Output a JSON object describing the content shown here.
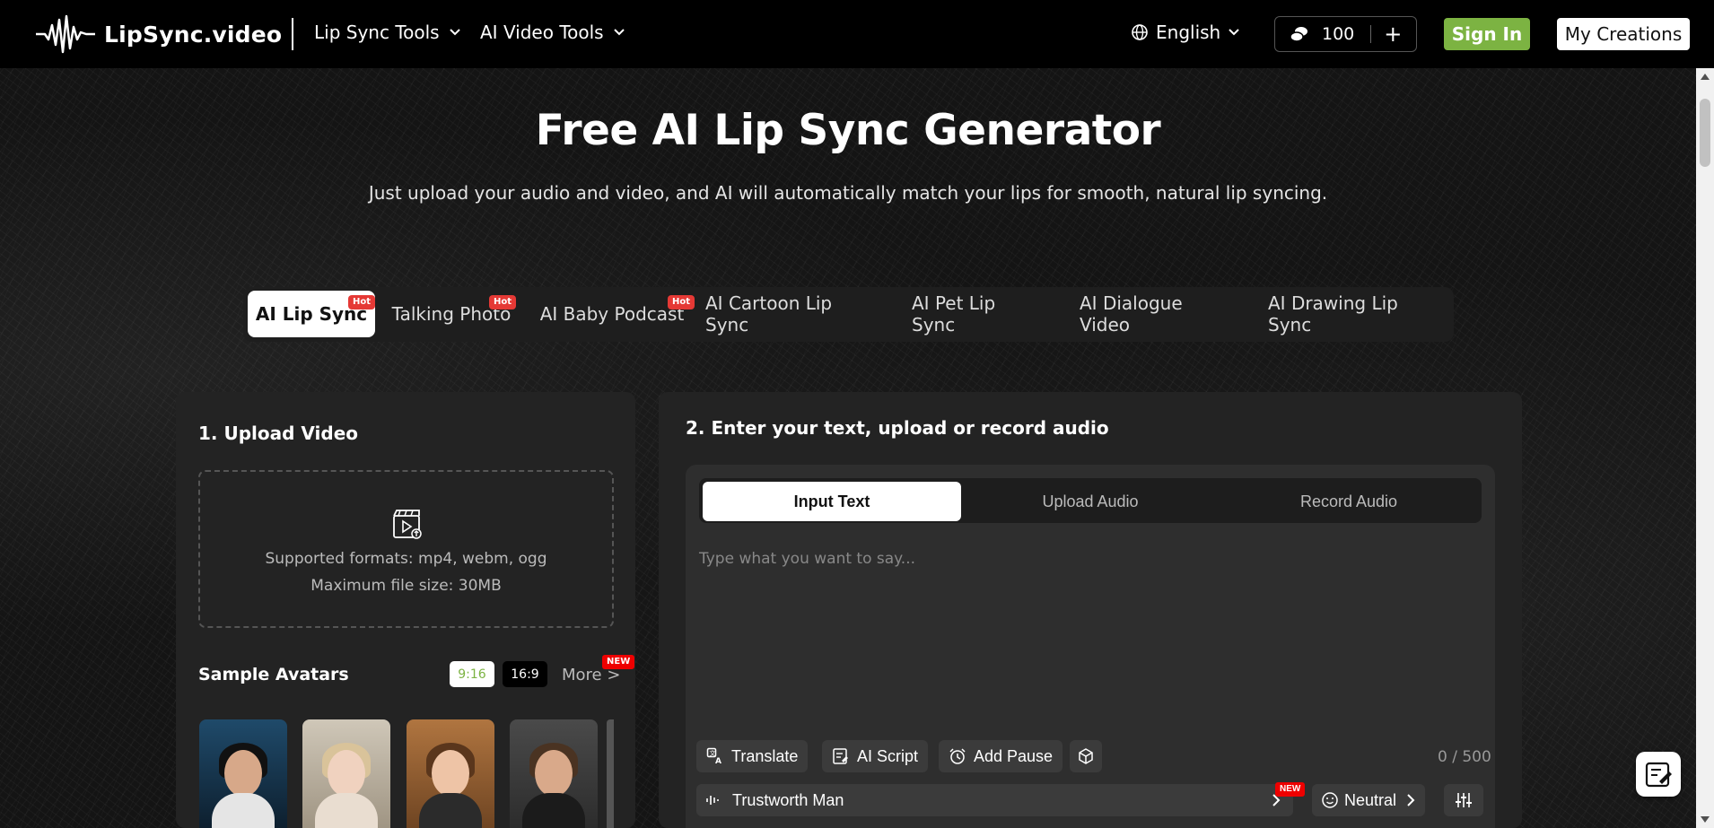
{
  "header": {
    "logo_text": "LipSync.video",
    "nav": [
      {
        "label": "Lip Sync Tools"
      },
      {
        "label": "AI Video Tools"
      }
    ],
    "language": "English",
    "credits": "100",
    "credits_add": "+",
    "sign_in": "Sign In",
    "my_creations": "My Creations"
  },
  "hero": {
    "title": "Free AI Lip Sync Generator",
    "subtitle": "Just upload your audio and video, and AI will automatically match your lips for smooth, natural lip syncing."
  },
  "tabs": [
    {
      "label": "AI Lip Sync",
      "badge": "Hot"
    },
    {
      "label": "Talking Photo",
      "badge": "Hot"
    },
    {
      "label": "AI Baby Podcast",
      "badge": "Hot"
    },
    {
      "label": "AI Cartoon Lip Sync"
    },
    {
      "label": "AI Pet Lip Sync"
    },
    {
      "label": "AI Dialogue Video"
    },
    {
      "label": "AI Drawing Lip Sync"
    }
  ],
  "upload": {
    "title": "1. Upload Video",
    "formats": "Supported formats: mp4, webm, ogg",
    "max_size": "Maximum file size: 30MB",
    "samples_label": "Sample Avatars",
    "ratio_a": "9:16",
    "ratio_b": "16:9",
    "more": "More >",
    "more_badge": "NEW"
  },
  "audio": {
    "title": "2. Enter your text, upload or record audio",
    "modes": [
      "Input Text",
      "Upload Audio",
      "Record Audio"
    ],
    "placeholder": "Type what you want to say...",
    "tools": {
      "translate": "Translate",
      "ai_script": "AI Script",
      "add_pause": "Add Pause"
    },
    "counter": "0 / 500",
    "voice": "Trustworth Man",
    "voice_badge": "NEW",
    "emotion": "Neutral"
  },
  "colors": {
    "accent_green": "#7cb342",
    "hot_red": "#e53935",
    "new_red": "#ee0000"
  }
}
